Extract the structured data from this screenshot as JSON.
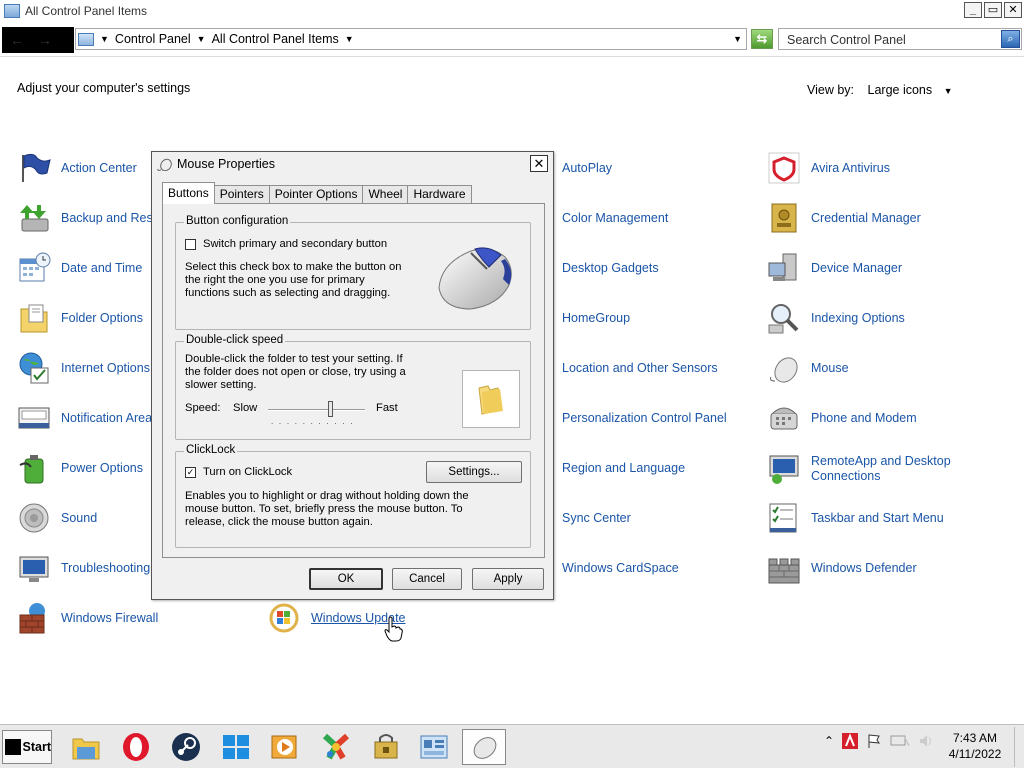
{
  "window": {
    "title": "All Control Panel Items",
    "buttons": {
      "minimize": "_",
      "restore": "▭",
      "close": "✕"
    }
  },
  "address": {
    "segments": [
      "Control Panel",
      "All Control Panel Items"
    ],
    "search_placeholder": "Search Control Panel"
  },
  "content": {
    "heading": "Adjust your computer's settings",
    "view_by_label": "View by:",
    "view_by_value": "Large icons"
  },
  "items": {
    "col1": [
      "Action Center",
      "Backup and Rest",
      "Date and Time",
      "Folder Options",
      "Internet Options",
      "Notification Area",
      "Power Options",
      "Sound",
      "Troubleshooting",
      "Windows Firewall"
    ],
    "col2": [
      "Windows Update"
    ],
    "col3": [
      "AutoPlay",
      "Color Management",
      "Desktop Gadgets",
      "HomeGroup",
      "Location and Other Sensors",
      "Personalization Control Panel",
      "Region and Language",
      "Sync Center",
      "Windows CardSpace"
    ],
    "col4": [
      "Avira Antivirus",
      "Credential Manager",
      "Device Manager",
      "Indexing Options",
      "Mouse",
      "Phone and Modem",
      "RemoteApp and Desktop Connections",
      "Taskbar and Start Menu",
      "Windows Defender"
    ],
    "col4_remoteapp_line1": "RemoteApp and Desktop",
    "col4_remoteapp_line2": "Connections"
  },
  "dialog": {
    "title": "Mouse Properties",
    "close": "✕",
    "tabs": [
      "Buttons",
      "Pointers",
      "Pointer Options",
      "Wheel",
      "Hardware"
    ],
    "button_config": {
      "label": "Button configuration",
      "checkbox_label": "Switch primary and secondary button",
      "checked": false,
      "desc_line1": "Select this check box to make the button on",
      "desc_line2": "the right the one you use for primary",
      "desc_line3": "functions such as selecting and dragging."
    },
    "double_click": {
      "label": "Double-click speed",
      "desc_line1": "Double-click the folder to test your setting. If",
      "desc_line2": "the folder does not open or close, try using a",
      "desc_line3": "slower setting.",
      "speed_label": "Speed:",
      "slow": "Slow",
      "fast": "Fast",
      "speed_value": 0.65
    },
    "clicklock": {
      "label": "ClickLock",
      "checkbox_label": "Turn on ClickLock",
      "checked": true,
      "settings_button": "Settings...",
      "desc_line1": "Enables you to highlight or drag without holding down the",
      "desc_line2": "mouse button. To set, briefly press the mouse button. To",
      "desc_line3": "release, click the mouse button again."
    },
    "buttons": {
      "ok": "OK",
      "cancel": "Cancel",
      "apply": "Apply"
    }
  },
  "taskbar": {
    "start": "Start",
    "time": "7:43 AM",
    "date": "4/11/2022"
  }
}
